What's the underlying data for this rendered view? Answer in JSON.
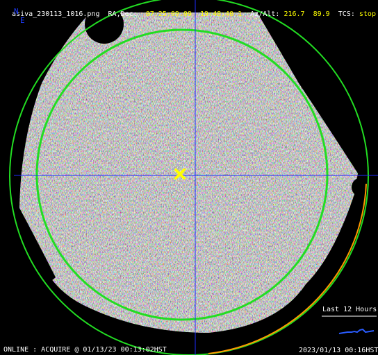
{
  "header": {
    "filename": "asiva_230113_1016.png",
    "radec_label": "RA,Dec:",
    "ra": "07:25:09.09",
    "dec": "19:48:40.1",
    "azalt_label": "Az/Alt:",
    "az": "216.7",
    "alt": "89.9",
    "tcs_label": "TCS:",
    "tcs_status": "stop"
  },
  "compass": {
    "north": "N",
    "east": "E"
  },
  "legend": {
    "label": "Last 12 Hours"
  },
  "footer": {
    "status": "ONLINE : ACQUIRE @ 01/13/23 00:13:02HST",
    "timestamp": "2023/01/13 00:16HST"
  },
  "colors": {
    "crosshair": "#1e2cff",
    "dome_circle": "#22dd22",
    "horizon_circle": "#22dd22",
    "arc_recent": "#ff9900",
    "target_marker": "#ffff00",
    "trend": "#2a5cff",
    "header_value": "#ffff00"
  },
  "icons": {
    "target": "x-cross-icon"
  }
}
